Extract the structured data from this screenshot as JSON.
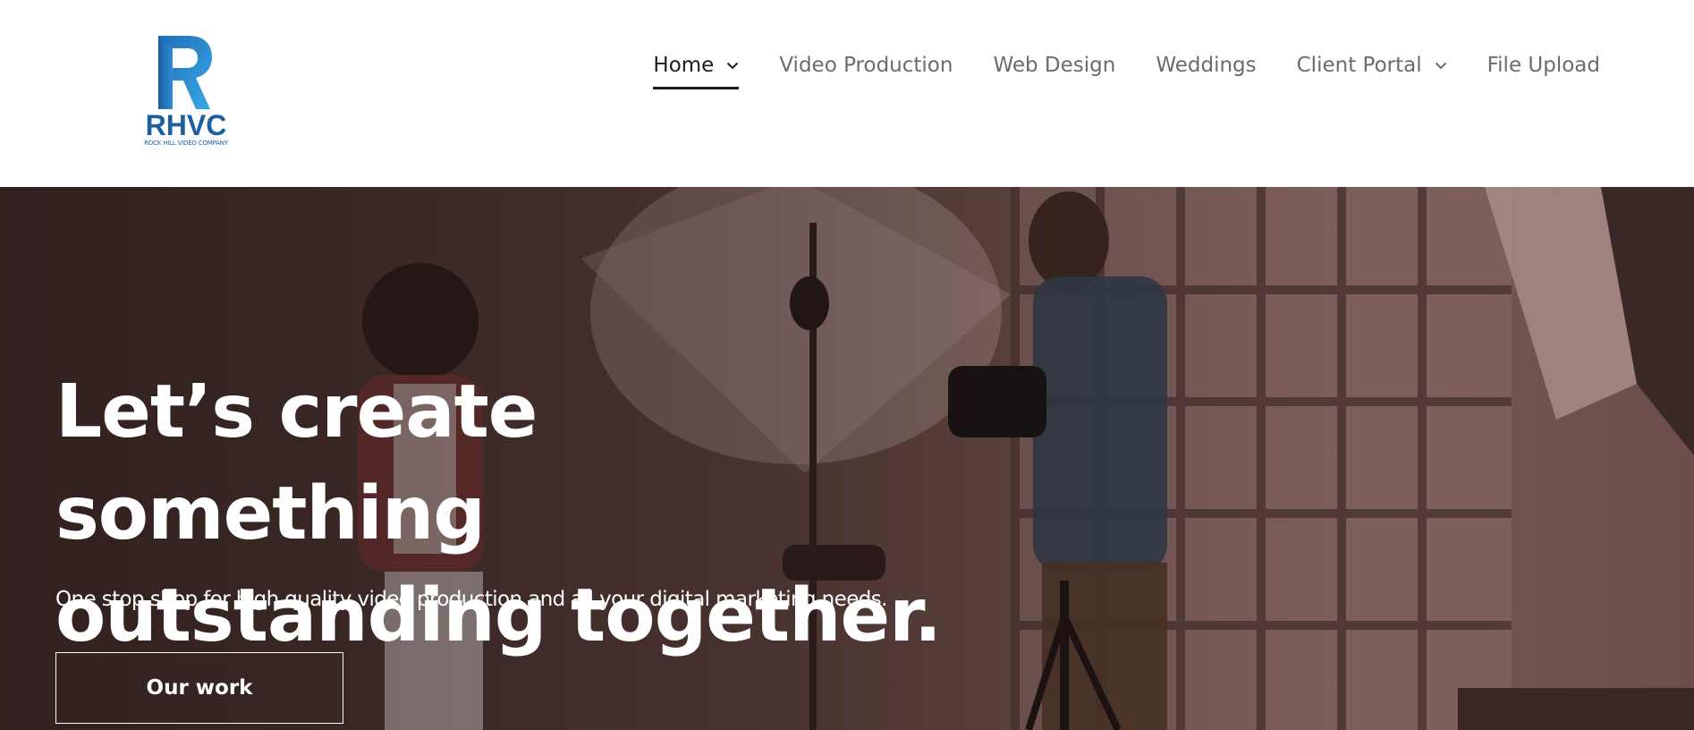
{
  "brand": {
    "logo_text": "RHVC",
    "logo_subtext": "ROCK HILL VIDEO COMPANY",
    "logo_icon": "r-monogram-logo",
    "colors": {
      "primary": "#1a5f9e",
      "light": "#3aa0e0"
    }
  },
  "nav": {
    "items": [
      {
        "label": "Home",
        "has_dropdown": true,
        "active": true
      },
      {
        "label": "Video Production",
        "has_dropdown": false,
        "active": false
      },
      {
        "label": "Web Design",
        "has_dropdown": false,
        "active": false
      },
      {
        "label": "Weddings",
        "has_dropdown": false,
        "active": false
      },
      {
        "label": "Client Portal",
        "has_dropdown": true,
        "active": false
      },
      {
        "label": "File Upload",
        "has_dropdown": false,
        "active": false
      }
    ],
    "colors": {
      "default": "#6b6b6b",
      "active": "#1c1c1c"
    }
  },
  "hero": {
    "title_line1": "Let’s create something",
    "title_line2": "outstanding together.",
    "subtitle": "One stop shop for high quality video production and all your digital marketing needs.",
    "cta_label": "Our work",
    "background": "photo-studio-shoot-image"
  }
}
